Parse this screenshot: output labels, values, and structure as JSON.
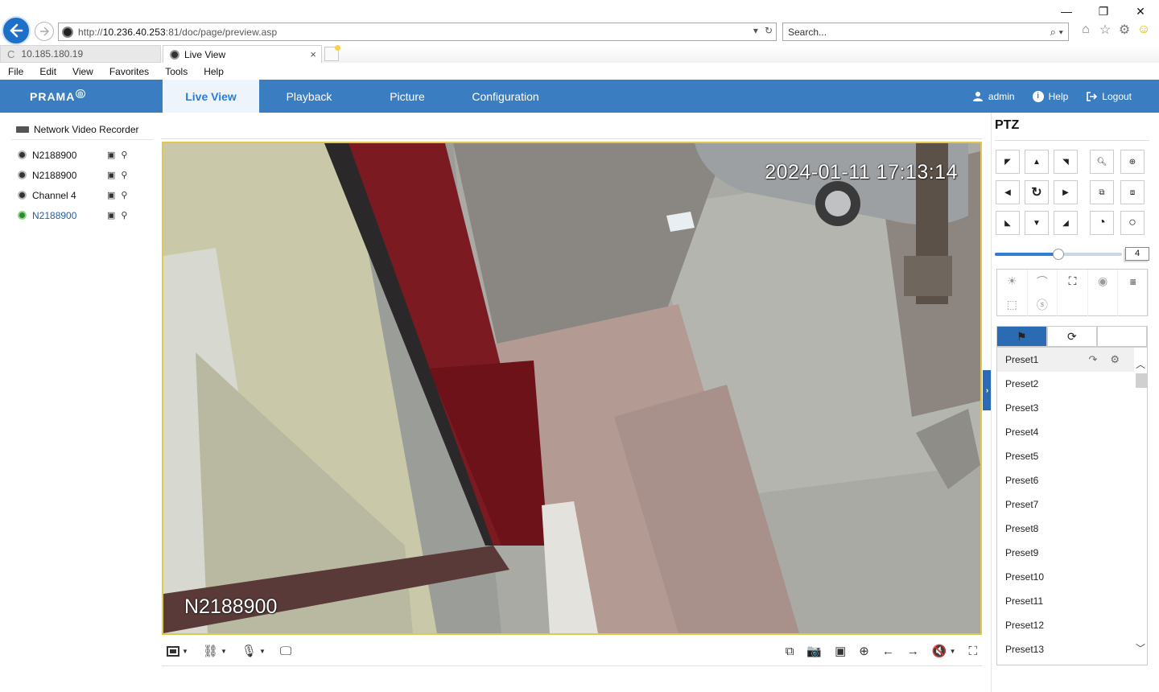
{
  "browser": {
    "url_prefix": "http://",
    "url_host": "10.236.40.253",
    "url_rest": ":81/doc/page/preview.asp",
    "search_placeholder": "Search...",
    "tabs": [
      {
        "label": "10.185.180.19"
      },
      {
        "label": "Live View"
      }
    ],
    "menu": [
      "File",
      "Edit",
      "View",
      "Favorites",
      "Tools",
      "Help"
    ]
  },
  "app": {
    "logo": "PRAMA",
    "nav_tabs": [
      "Live View",
      "Playback",
      "Picture",
      "Configuration"
    ],
    "user": "admin",
    "help": "Help",
    "logout": "Logout",
    "accent_color": "#3a7dc0"
  },
  "tree": {
    "root": "Network Video Recorder",
    "channels": [
      {
        "label": "N2188900"
      },
      {
        "label": "N2188900"
      },
      {
        "label": "Channel 4"
      },
      {
        "label": "N2188900"
      }
    ]
  },
  "video": {
    "timestamp": "2024-01-11 17:13:14",
    "channel_name": "N2188900"
  },
  "ptz": {
    "title": "PTZ",
    "speed": "4",
    "speed_level": 0.5,
    "presets": [
      "Preset1",
      "Preset2",
      "Preset3",
      "Preset4",
      "Preset5",
      "Preset6",
      "Preset7",
      "Preset8",
      "Preset9",
      "Preset10",
      "Preset11",
      "Preset12",
      "Preset13"
    ]
  }
}
